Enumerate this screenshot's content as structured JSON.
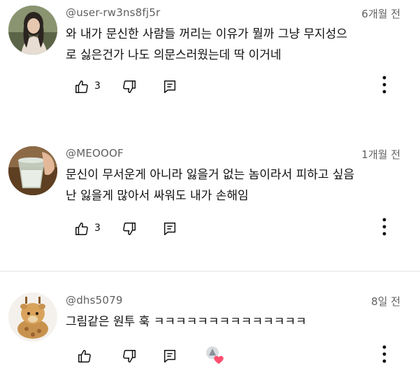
{
  "comments": [
    {
      "author": "@user-rw3ns8fj5r",
      "time": "6개월 전",
      "text": "와 내가 문신한 사람들 꺼리는 이유가 뭘까 그냥 무지성으\n로 싫은건가 나도 의문스러웠는데 딱 이거네",
      "likes": "3",
      "avatar": "photo-woman-avatar"
    },
    {
      "author": "@MEOOOF",
      "time": "1개월 전",
      "text": "문신이 무서운게 아니라 잃을거 없는 놈이라서 피하고 싶음\n난 잃을게 많아서 싸워도 내가 손해임",
      "likes": "3",
      "avatar": "glass-drink-avatar"
    },
    {
      "author": "@dhs5079",
      "time": "8일 전",
      "text": "그림같은 원투 훅 ㅋㅋㅋㅋㅋㅋㅋㅋㅋㅋㅋㅋㅋㅋ",
      "likes": "",
      "avatar": "giraffe-plush-avatar"
    }
  ],
  "icons": {
    "like": "thumbs-up-icon",
    "dislike": "thumbs-down-icon",
    "reply": "reply-comment-icon",
    "more": "more-vertical-icon",
    "creator_heart": "creator-heart-icon"
  },
  "colors": {
    "text_primary": "#0f0f0f",
    "text_secondary": "#606060",
    "heart": "#ff4e6e"
  }
}
